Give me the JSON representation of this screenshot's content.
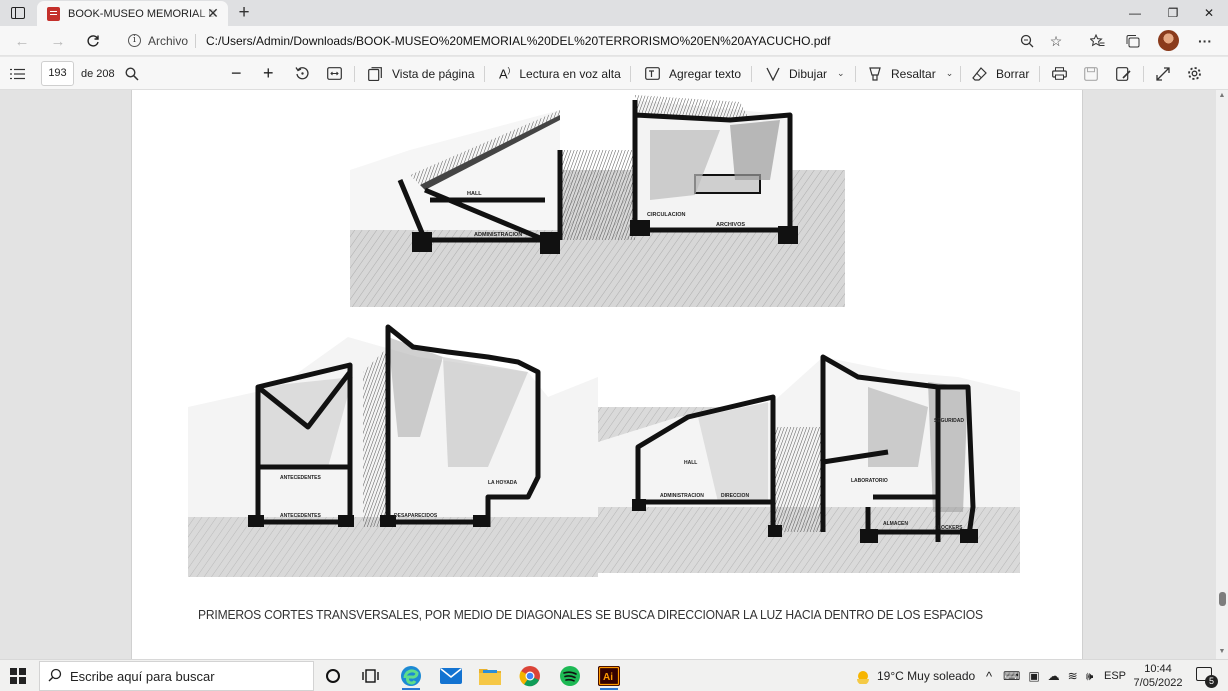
{
  "browser": {
    "tab_title": "BOOK-MUSEO MEMORIAL DEL TERRORISMO EN AYACUCHO.pdf",
    "site_label": "Archivo",
    "url": "C:/Users/Admin/Downloads/BOOK-MUSEO%20MEMORIAL%20DEL%20TERRORISMO%20EN%20AYACUCHO.pdf",
    "window_controls": {
      "minimize": "—",
      "restore": "❐",
      "close": "✕"
    },
    "more_label": "···"
  },
  "pdf_toolbar": {
    "page_current": "193",
    "page_total": "de 208",
    "page_view": "Vista de página",
    "read_aloud": "Lectura en voz alta",
    "add_text": "Agregar texto",
    "draw": "Dibujar",
    "highlight": "Resaltar",
    "erase": "Borrar"
  },
  "document": {
    "caption": "PRIMEROS CORTES TRANSVERSALES, POR MEDIO DE DIAGONALES SE BUSCA DIRECCIONAR LA LUZ HACIA DENTRO DE LOS ESPACIOS",
    "section_top_labels": {
      "hall": "HALL",
      "admin": "ADMINISTRACION",
      "circulation": "CIRCULACION",
      "archives": "ARCHIVOS"
    },
    "section_left_labels": {
      "antecedentes_upper": "ANTECEDENTES",
      "antecedentes_lower": "ANTECEDENTES",
      "desaparecidos": "DESAPARECIDOS",
      "hoyada": "LA HOYADA"
    },
    "section_right_labels": {
      "hall": "HALL",
      "admin": "ADMINISTRACION",
      "direccion": "DIRECCION",
      "seguridad": "SEGURIDAD",
      "laboratorio": "LABORATORIO",
      "almacen": "ALMACEN",
      "lockers": "LOCKERS"
    }
  },
  "taskbar": {
    "search_placeholder": "Escribe aquí para buscar",
    "weather": "19°C  Muy soleado",
    "language": "ESP",
    "time": "10:44",
    "date": "7/05/2022",
    "notification_count": "5"
  },
  "colors": {
    "accent": "#2b76d2",
    "pdf_red": "#c4302b"
  }
}
